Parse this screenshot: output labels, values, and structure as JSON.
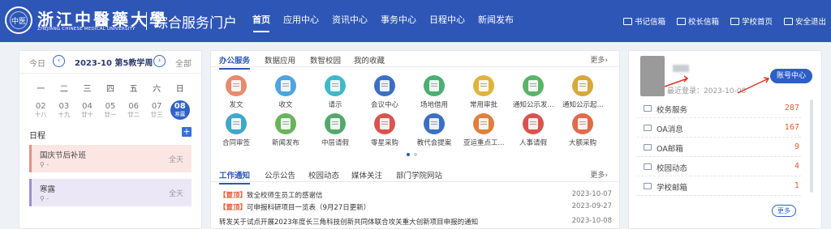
{
  "header": {
    "logo_seal_char": "中医",
    "logo_cn": "浙江中醫藥大學",
    "logo_en": "ZHEJIANG CHINESE MEDICAL UNIVERSITY",
    "portal_title": "综合服务门户",
    "nav": [
      "首页",
      "应用中心",
      "资讯中心",
      "事务中心",
      "日程中心",
      "新闻发布"
    ],
    "links": [
      {
        "label": "书记信箱",
        "icon": "mail-icon"
      },
      {
        "label": "校长信箱",
        "icon": "mail-icon"
      },
      {
        "label": "学校首页",
        "icon": "home-icon"
      },
      {
        "label": "安全退出",
        "icon": "logout-icon"
      }
    ]
  },
  "calendar": {
    "today_label": "今日",
    "week_label": "2023-10 第5教学周",
    "all_label": "全部",
    "weekdays": [
      "一",
      "二",
      "三",
      "四",
      "五",
      "六",
      "日"
    ],
    "days": [
      {
        "num": "02",
        "lunar": "十八"
      },
      {
        "num": "03",
        "lunar": "十九"
      },
      {
        "num": "04",
        "lunar": "廿十"
      },
      {
        "num": "05",
        "lunar": "廿一"
      },
      {
        "num": "06",
        "lunar": "廿二"
      },
      {
        "num": "07",
        "lunar": "廿三"
      },
      {
        "num": "08",
        "lunar": "寒露"
      }
    ],
    "schedule_label": "日程",
    "add_label": "+",
    "events": [
      {
        "title": "国庆节后补班",
        "location": "-",
        "allday": "全天"
      },
      {
        "title": "寒露",
        "location": "-",
        "allday": "全天"
      }
    ]
  },
  "office": {
    "tabs": [
      "办公服务",
      "数据应用",
      "数智校园",
      "我的收藏"
    ],
    "more": "更多›",
    "apps": [
      {
        "label": "发文",
        "color": "#e98a6c"
      },
      {
        "label": "收文",
        "color": "#4fa3e0"
      },
      {
        "label": "请示",
        "color": "#3fb9c9"
      },
      {
        "label": "会议中心",
        "color": "#3c6fc4"
      },
      {
        "label": "场地借用",
        "color": "#4cae72"
      },
      {
        "label": "常用审批",
        "color": "#e0b43c"
      },
      {
        "label": "通知公示发...",
        "color": "#5ab36a"
      },
      {
        "label": "通知公示起...",
        "color": "#d9a83a"
      },
      {
        "label": "合同审签",
        "color": "#3fa7c9"
      },
      {
        "label": "新闻发布",
        "color": "#69b35a"
      },
      {
        "label": "中层请假",
        "color": "#55a86c"
      },
      {
        "label": "零星采购",
        "color": "#d9534f"
      },
      {
        "label": "教代会提案",
        "color": "#3c6fc4"
      },
      {
        "label": "亚运重点工...",
        "color": "#e0803c"
      },
      {
        "label": "人事请假",
        "color": "#d9534f"
      },
      {
        "label": "大额采购",
        "color": "#e06a4a"
      }
    ]
  },
  "notices": {
    "tabs": [
      "工作通知",
      "公示公告",
      "校园动态",
      "媒体关注",
      "部门学院网站"
    ],
    "more": "更多›",
    "items": [
      {
        "tag": "【置顶】",
        "title": "致全校师生员工的感谢信",
        "date": "2023-10-07"
      },
      {
        "tag": "【置顶】",
        "title": "可申报科研项目一览表（9月27日更新）",
        "date": "2023-09-27"
      },
      {
        "tag": "",
        "title": "转发关于试点开展2023年度长三角科技创新共同体联合攻关重大创新项目申报的通知",
        "date": "2023-10-08"
      }
    ]
  },
  "user": {
    "last_login": "最近登录：2023-10-08",
    "account_button": "账号中心",
    "items": [
      {
        "label": "校务服务",
        "count": "287"
      },
      {
        "label": "OA消息",
        "count": "167"
      },
      {
        "label": "OA邮箱",
        "count": "9"
      },
      {
        "label": "校园动态",
        "count": "4"
      },
      {
        "label": "学校邮箱",
        "count": "1"
      }
    ],
    "more": "更多"
  },
  "colors": {
    "brand": "#2d56b6",
    "accent_red": "#e4572e"
  }
}
